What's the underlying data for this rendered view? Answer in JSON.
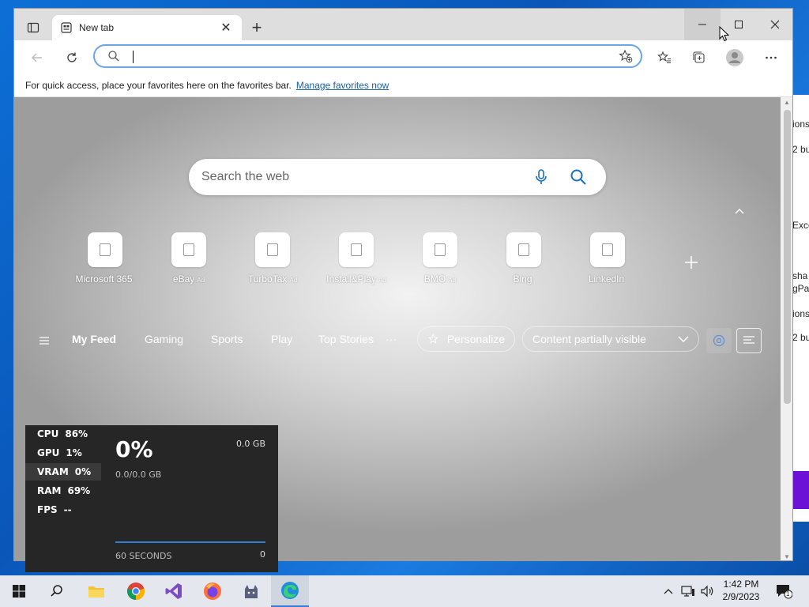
{
  "browser": {
    "tab_title": "New tab",
    "address_value": "",
    "favorites_bar": {
      "message": "For quick access, place your favorites here on the favorites bar.",
      "link": "Manage favorites now"
    }
  },
  "ntp": {
    "search_placeholder": "Search the web",
    "quick_links": [
      {
        "label": "Microsoft 365",
        "ad": ""
      },
      {
        "label": "eBay",
        "ad": "Ad"
      },
      {
        "label": "TurboTax",
        "ad": "Ad"
      },
      {
        "label": "Install&Play",
        "ad": "Ad"
      },
      {
        "label": "BMO",
        "ad": "Ad"
      },
      {
        "label": "Bing",
        "ad": ""
      },
      {
        "label": "LinkedIn",
        "ad": ""
      }
    ],
    "feed_tabs": [
      "My Feed",
      "Gaming",
      "Sports",
      "Play",
      "Top Stories"
    ],
    "more_label": "···",
    "personalize_label": "Personalize",
    "content_select": "Content partially visible"
  },
  "perf": {
    "stats": [
      {
        "label": "CPU",
        "value": "86%"
      },
      {
        "label": "GPU",
        "value": "1%"
      },
      {
        "label": "VRAM",
        "value": "0%"
      },
      {
        "label": "RAM",
        "value": "69%"
      },
      {
        "label": "FPS",
        "value": "--"
      }
    ],
    "big_value": "0%",
    "usage": "0.0/0.0 GB",
    "total": "0.0 GB",
    "seconds": "60 SECONDS",
    "zero": "0"
  },
  "background_window": {
    "fragments": [
      "ions",
      "2 bu",
      "Exce",
      "sha",
      "gPa",
      "ions",
      "2 bu"
    ]
  },
  "taskbar": {
    "time": "1:42 PM",
    "date": "2/9/2023",
    "notification_count": "1"
  },
  "colors": {
    "accent": "#2f7fd6",
    "link": "#1a5ea8",
    "address_border": "#6aa6e6"
  }
}
